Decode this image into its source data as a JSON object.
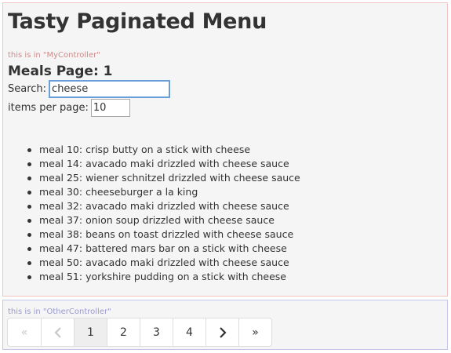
{
  "page": {
    "title": "Tasty Paginated Menu"
  },
  "my_controller": {
    "note": "this is in \"MyController\"",
    "meals_page_label": "Meals Page: 1",
    "search": {
      "label": "Search:",
      "value": "cheese"
    },
    "items_per_page": {
      "label": "items per page:",
      "value": "10"
    },
    "meals": [
      "meal 10: crisp butty on a stick with cheese",
      "meal 14: avacado maki drizzled with cheese sauce",
      "meal 25: wiener schnitzel drizzled with cheese sauce",
      "meal 30: cheeseburger a la king",
      "meal 32: avacado maki drizzled with cheese sauce",
      "meal 37: onion soup drizzled with cheese sauce",
      "meal 38: beans on toast drizzled with cheese sauce",
      "meal 47: battered mars bar on a stick with cheese",
      "meal 50: avacado maki drizzled with cheese sauce",
      "meal 51: yorkshire pudding on a stick with cheese"
    ]
  },
  "other_controller": {
    "note": "this is in \"OtherController\"",
    "pagination": {
      "first": "«",
      "prev_icon": "chevron-left-icon",
      "pages": [
        "1",
        "2",
        "3",
        "4"
      ],
      "active_page": "1",
      "next_icon": "chevron-right-icon",
      "last": "»"
    }
  },
  "colors": {
    "my_controller_border": "#f3c3c3",
    "other_controller_border": "#c5c5ec",
    "search_focus": "#6a9fd8"
  }
}
